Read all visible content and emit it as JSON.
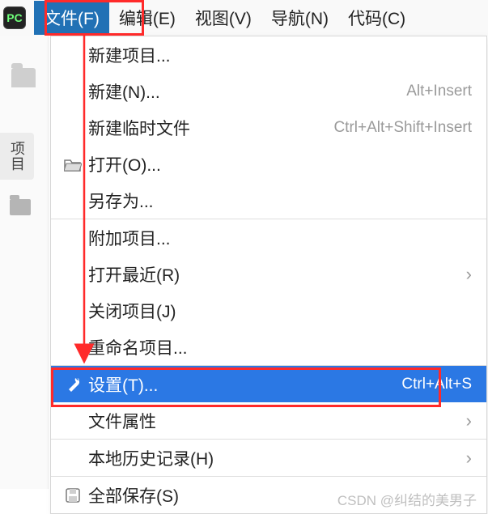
{
  "app_icon_text": "PC",
  "menubar": [
    {
      "label": "文件(F)",
      "open": true
    },
    {
      "label": "编辑(E)"
    },
    {
      "label": "视图(V)"
    },
    {
      "label": "导航(N)"
    },
    {
      "label": "代码(C)"
    }
  ],
  "side_tab_label": "项目",
  "menu": {
    "new_project": "新建项目...",
    "new": "新建(N)...",
    "new_shortcut": "Alt+Insert",
    "new_scratch": "新建临时文件",
    "new_scratch_shortcut": "Ctrl+Alt+Shift+Insert",
    "open": "打开(O)...",
    "save_as": "另存为...",
    "attach_project": "附加项目...",
    "open_recent": "打开最近(R)",
    "close_project": "关闭项目(J)",
    "rename_project": "重命名项目...",
    "settings": "设置(T)...",
    "settings_shortcut": "Ctrl+Alt+S",
    "file_props": "文件属性",
    "local_history": "本地历史记录(H)",
    "save_all": "全部保存(S)"
  },
  "watermark": "CSDN @纠结的美男子"
}
